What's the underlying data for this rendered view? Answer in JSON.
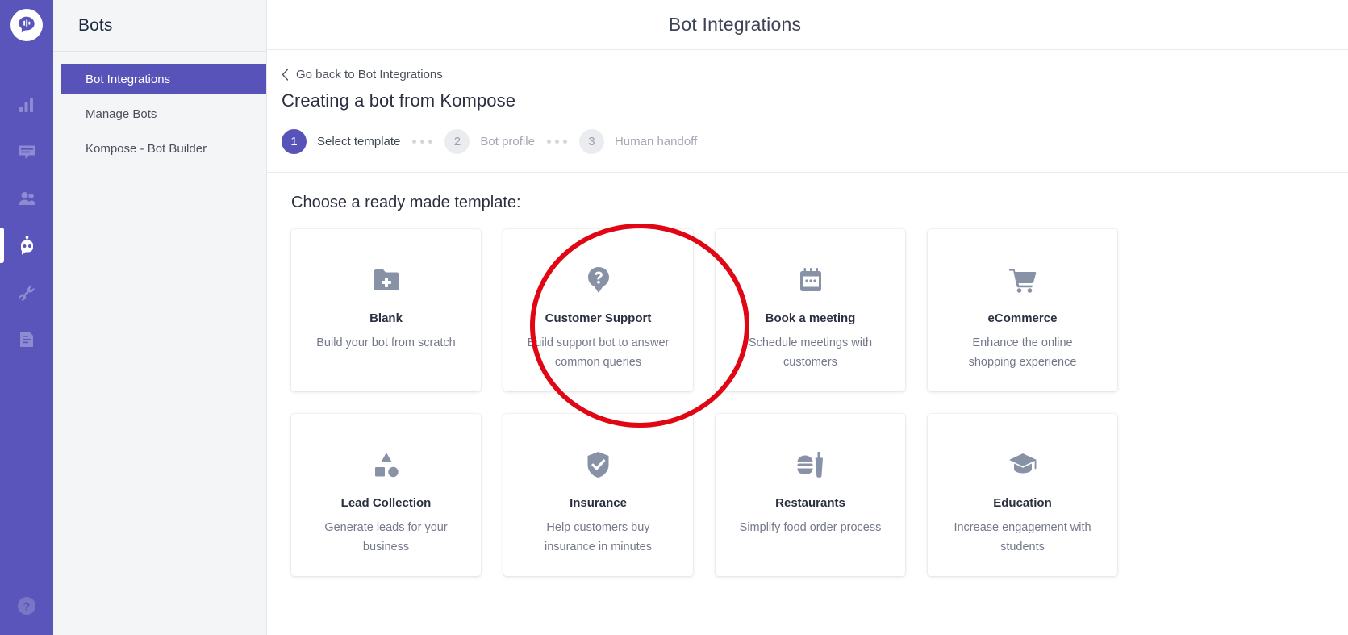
{
  "colors": {
    "rail_purple": "#5a55ba",
    "accent_purple": "#5753b8",
    "sidebar_bg": "#f4f5f7",
    "annotation_red": "#e00613",
    "icon_gray": "#8792a6"
  },
  "rail": {
    "logo_name": "kommunicate-logo-icon",
    "items": [
      {
        "name": "analytics-icon",
        "label": "Analytics",
        "active": false
      },
      {
        "name": "conversations-icon",
        "label": "Conversations",
        "active": false
      },
      {
        "name": "users-icon",
        "label": "Users",
        "active": false
      },
      {
        "name": "bots-icon",
        "label": "Bots",
        "active": true
      },
      {
        "name": "integrations-plug-icon",
        "label": "Integrations",
        "active": false
      },
      {
        "name": "docs-icon",
        "label": "Docs",
        "active": false
      }
    ],
    "help": {
      "name": "help-circle-icon",
      "label": "Help"
    }
  },
  "sidebar": {
    "title": "Bots",
    "items": [
      {
        "label": "Bot Integrations",
        "active": true
      },
      {
        "label": "Manage Bots",
        "active": false
      },
      {
        "label": "Kompose - Bot Builder",
        "active": false
      }
    ]
  },
  "header": {
    "title": "Bot Integrations"
  },
  "content": {
    "back_link": "Go back to Bot Integrations",
    "back_icon": "chevron-left-icon",
    "page_title": "Creating a bot from Kompose",
    "section_title": "Choose a ready made template:"
  },
  "stepper": {
    "steps": [
      {
        "number": "1",
        "label": "Select template",
        "active": true
      },
      {
        "number": "2",
        "label": "Bot profile",
        "active": false
      },
      {
        "number": "3",
        "label": "Human handoff",
        "active": false
      }
    ]
  },
  "templates": [
    {
      "icon": "folder-plus-icon",
      "title": "Blank",
      "desc": "Build your bot from scratch"
    },
    {
      "icon": "question-chat-icon",
      "title": "Customer Support",
      "desc": "Build support bot to answer common queries"
    },
    {
      "icon": "calendar-icon",
      "title": "Book a meeting",
      "desc": "Schedule meetings with customers"
    },
    {
      "icon": "shopping-cart-icon",
      "title": "eCommerce",
      "desc": "Enhance the online shopping experience"
    },
    {
      "icon": "shapes-icon",
      "title": "Lead Collection",
      "desc": "Generate leads for your business"
    },
    {
      "icon": "shield-check-icon",
      "title": "Insurance",
      "desc": "Help customers buy insurance in minutes"
    },
    {
      "icon": "fast-food-icon",
      "title": "Restaurants",
      "desc": "Simplify food order process"
    },
    {
      "icon": "graduation-cap-icon",
      "title": "Education",
      "desc": "Increase engagement with students"
    }
  ],
  "annotation": {
    "name": "red-highlight-circle",
    "target": "Blank"
  }
}
